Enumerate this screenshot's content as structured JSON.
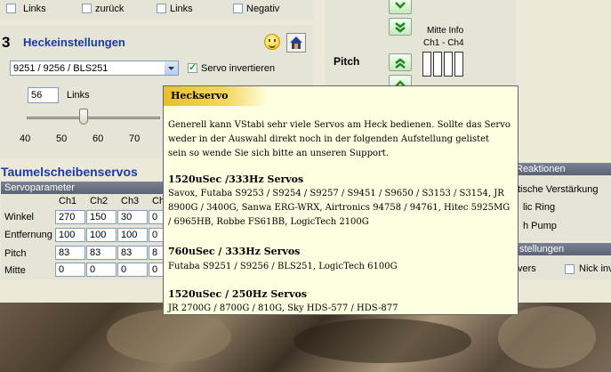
{
  "top_row": {
    "items": [
      {
        "label": "Links"
      },
      {
        "label": "zurück"
      },
      {
        "label": "Links"
      },
      {
        "label": "Negativ"
      }
    ]
  },
  "section3": {
    "number": "3",
    "title": "Heckeinstellungen",
    "servo_select": "9251 / 9256 / BLS251",
    "servo_invert_label": "Servo invertieren",
    "servo_invert_checked": true,
    "value": "56",
    "direction": "Links",
    "slider_value": 56,
    "ticks": [
      "40",
      "50",
      "60",
      "70"
    ]
  },
  "right_panel": {
    "mitte_info": "Mitte Info",
    "channels": "Ch1 - Ch4",
    "pitch": "Pitch"
  },
  "swash": {
    "title": "Taumelscheibenservos",
    "param_header": "Servoparameter",
    "columns": [
      "Ch1",
      "Ch2",
      "Ch3",
      "Ch4"
    ],
    "rows": [
      {
        "label": "Winkel",
        "values": [
          "270",
          "150",
          "30",
          "0"
        ]
      },
      {
        "label": "Entfernung",
        "values": [
          "100",
          "100",
          "100",
          "0"
        ]
      },
      {
        "label": "Pitch",
        "values": [
          "83",
          "83",
          "83",
          "8"
        ]
      },
      {
        "label": "Mitte",
        "values": [
          "0",
          "0",
          "0",
          "0"
        ]
      }
    ]
  },
  "reactions": {
    "header": "Reaktionen",
    "items": [
      "tische Verstärkung",
      "lic Ring",
      "h Pump"
    ],
    "settings_header": "stellungen",
    "settings_left": "vers",
    "settings_right": "Nick inv"
  },
  "tooltip": {
    "title": "Heckservo",
    "intro": [
      "Generell kann VStabi sehr viele Servos am Heck bedienen. Sollte das Servo",
      "weder in der Auswahl direkt noch in der folgenden Aufstellung gelistet",
      "sein so wende Sie sich bitte an unseren Support."
    ],
    "groups": [
      {
        "heading": "1520uSec /333Hz Servos",
        "lines": [
          "Savox, Futaba S9253 / S9254 / S9257 / S9451 / S9650 / S3153 / S3154, JR",
          "8900G / 3400G, Sanwa ERG-WRX, Airtronics 94758 / 94761, Hitec 5925MG",
          "/ 6965HB, Robbe FS61BB, LogicTech 2100G"
        ]
      },
      {
        "heading": "760uSec / 333Hz Servos",
        "lines": [
          "Futaba S9251 / S9256 / BLS251, LogicTech 6100G"
        ]
      },
      {
        "heading": "1520uSec / 250Hz Servos",
        "lines": [
          "JR 2700G / 8700G / 810G, Sky HDS-577 / HDS-877"
        ]
      }
    ]
  },
  "colors": {
    "accent_blue": "#1a3aa8",
    "tooltip_bg": "#ffffe1",
    "tooltip_head": "#e8c028"
  }
}
